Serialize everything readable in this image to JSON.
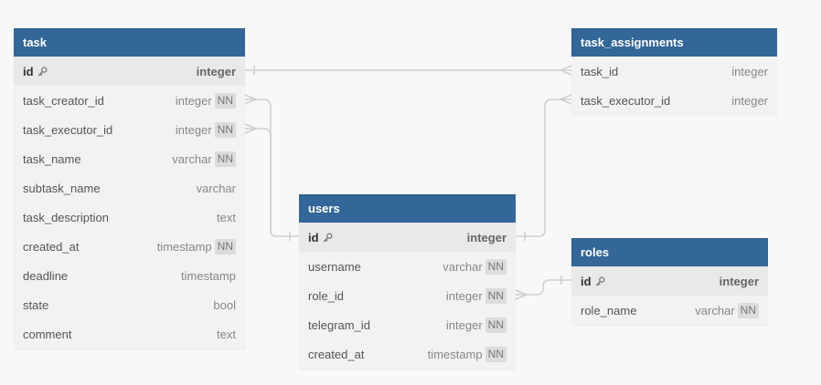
{
  "tables": [
    {
      "id": "task",
      "name": "task",
      "columns": [
        {
          "name": "id",
          "type": "integer",
          "pk": true,
          "nn": false
        },
        {
          "name": "task_creator_id",
          "type": "integer",
          "pk": false,
          "nn": true
        },
        {
          "name": "task_executor_id",
          "type": "integer",
          "pk": false,
          "nn": true
        },
        {
          "name": "task_name",
          "type": "varchar",
          "pk": false,
          "nn": true
        },
        {
          "name": "subtask_name",
          "type": "varchar",
          "pk": false,
          "nn": false
        },
        {
          "name": "task_description",
          "type": "text",
          "pk": false,
          "nn": false
        },
        {
          "name": "created_at",
          "type": "timestamp",
          "pk": false,
          "nn": true
        },
        {
          "name": "deadline",
          "type": "timestamp",
          "pk": false,
          "nn": false
        },
        {
          "name": "state",
          "type": "bool",
          "pk": false,
          "nn": false
        },
        {
          "name": "comment",
          "type": "text",
          "pk": false,
          "nn": false
        }
      ]
    },
    {
      "id": "task_assignments",
      "name": "task_assignments",
      "columns": [
        {
          "name": "task_id",
          "type": "integer",
          "pk": false,
          "nn": false
        },
        {
          "name": "task_executor_id",
          "type": "integer",
          "pk": false,
          "nn": false
        }
      ]
    },
    {
      "id": "users",
      "name": "users",
      "columns": [
        {
          "name": "id",
          "type": "integer",
          "pk": true,
          "nn": false
        },
        {
          "name": "username",
          "type": "varchar",
          "pk": false,
          "nn": true
        },
        {
          "name": "role_id",
          "type": "integer",
          "pk": false,
          "nn": true
        },
        {
          "name": "telegram_id",
          "type": "integer",
          "pk": false,
          "nn": true
        },
        {
          "name": "created_at",
          "type": "timestamp",
          "pk": false,
          "nn": true
        }
      ]
    },
    {
      "id": "roles",
      "name": "roles",
      "columns": [
        {
          "name": "id",
          "type": "integer",
          "pk": true,
          "nn": false
        },
        {
          "name": "role_name",
          "type": "varchar",
          "pk": false,
          "nn": true
        }
      ]
    }
  ],
  "nn_label": "NN",
  "relations": [
    {
      "from": "task.id",
      "to": "task_assignments.task_id",
      "from_end": "one",
      "to_end": "many"
    },
    {
      "from": "task.task_creator_id",
      "to": "users.id",
      "from_end": "many",
      "to_end": "one"
    },
    {
      "from": "task.task_executor_id",
      "to": "users.id",
      "from_end": "many",
      "to_end": "one"
    },
    {
      "from": "task_assignments.task_executor_id",
      "to": "users.id",
      "from_end": "many",
      "to_end": "one"
    },
    {
      "from": "users.role_id",
      "to": "roles.id",
      "from_end": "many",
      "to_end": "one"
    }
  ],
  "colors": {
    "header": "#336699",
    "body": "#f2f2f2",
    "pk_row": "#e9e9e9",
    "connector": "#cfcfcf",
    "background": "#f8f8f8"
  },
  "icons": {
    "primary_key": "key-icon"
  }
}
